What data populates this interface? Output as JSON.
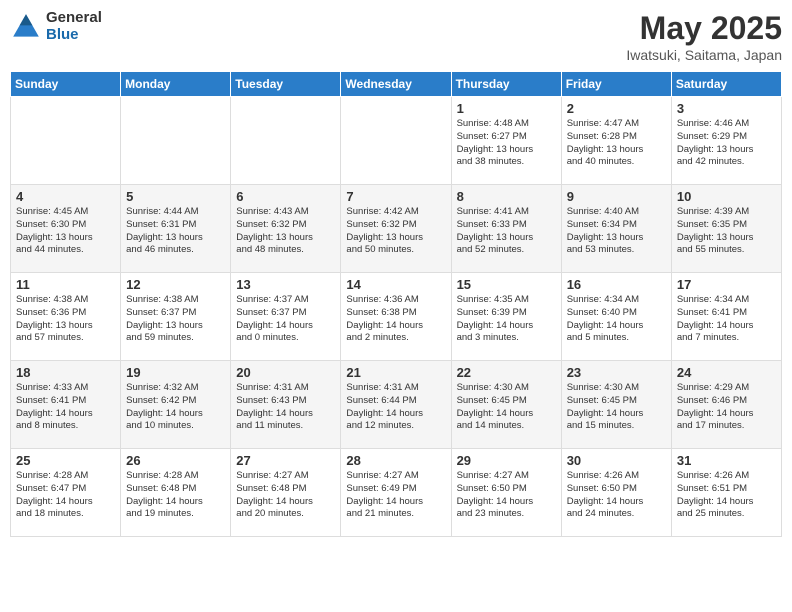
{
  "header": {
    "logo_general": "General",
    "logo_blue": "Blue",
    "month_title": "May 2025",
    "location": "Iwatsuki, Saitama, Japan"
  },
  "days_of_week": [
    "Sunday",
    "Monday",
    "Tuesday",
    "Wednesday",
    "Thursday",
    "Friday",
    "Saturday"
  ],
  "weeks": [
    [
      {
        "day": "",
        "info": ""
      },
      {
        "day": "",
        "info": ""
      },
      {
        "day": "",
        "info": ""
      },
      {
        "day": "",
        "info": ""
      },
      {
        "day": "1",
        "info": "Sunrise: 4:48 AM\nSunset: 6:27 PM\nDaylight: 13 hours\nand 38 minutes."
      },
      {
        "day": "2",
        "info": "Sunrise: 4:47 AM\nSunset: 6:28 PM\nDaylight: 13 hours\nand 40 minutes."
      },
      {
        "day": "3",
        "info": "Sunrise: 4:46 AM\nSunset: 6:29 PM\nDaylight: 13 hours\nand 42 minutes."
      }
    ],
    [
      {
        "day": "4",
        "info": "Sunrise: 4:45 AM\nSunset: 6:30 PM\nDaylight: 13 hours\nand 44 minutes."
      },
      {
        "day": "5",
        "info": "Sunrise: 4:44 AM\nSunset: 6:31 PM\nDaylight: 13 hours\nand 46 minutes."
      },
      {
        "day": "6",
        "info": "Sunrise: 4:43 AM\nSunset: 6:32 PM\nDaylight: 13 hours\nand 48 minutes."
      },
      {
        "day": "7",
        "info": "Sunrise: 4:42 AM\nSunset: 6:32 PM\nDaylight: 13 hours\nand 50 minutes."
      },
      {
        "day": "8",
        "info": "Sunrise: 4:41 AM\nSunset: 6:33 PM\nDaylight: 13 hours\nand 52 minutes."
      },
      {
        "day": "9",
        "info": "Sunrise: 4:40 AM\nSunset: 6:34 PM\nDaylight: 13 hours\nand 53 minutes."
      },
      {
        "day": "10",
        "info": "Sunrise: 4:39 AM\nSunset: 6:35 PM\nDaylight: 13 hours\nand 55 minutes."
      }
    ],
    [
      {
        "day": "11",
        "info": "Sunrise: 4:38 AM\nSunset: 6:36 PM\nDaylight: 13 hours\nand 57 minutes."
      },
      {
        "day": "12",
        "info": "Sunrise: 4:38 AM\nSunset: 6:37 PM\nDaylight: 13 hours\nand 59 minutes."
      },
      {
        "day": "13",
        "info": "Sunrise: 4:37 AM\nSunset: 6:37 PM\nDaylight: 14 hours\nand 0 minutes."
      },
      {
        "day": "14",
        "info": "Sunrise: 4:36 AM\nSunset: 6:38 PM\nDaylight: 14 hours\nand 2 minutes."
      },
      {
        "day": "15",
        "info": "Sunrise: 4:35 AM\nSunset: 6:39 PM\nDaylight: 14 hours\nand 3 minutes."
      },
      {
        "day": "16",
        "info": "Sunrise: 4:34 AM\nSunset: 6:40 PM\nDaylight: 14 hours\nand 5 minutes."
      },
      {
        "day": "17",
        "info": "Sunrise: 4:34 AM\nSunset: 6:41 PM\nDaylight: 14 hours\nand 7 minutes."
      }
    ],
    [
      {
        "day": "18",
        "info": "Sunrise: 4:33 AM\nSunset: 6:41 PM\nDaylight: 14 hours\nand 8 minutes."
      },
      {
        "day": "19",
        "info": "Sunrise: 4:32 AM\nSunset: 6:42 PM\nDaylight: 14 hours\nand 10 minutes."
      },
      {
        "day": "20",
        "info": "Sunrise: 4:31 AM\nSunset: 6:43 PM\nDaylight: 14 hours\nand 11 minutes."
      },
      {
        "day": "21",
        "info": "Sunrise: 4:31 AM\nSunset: 6:44 PM\nDaylight: 14 hours\nand 12 minutes."
      },
      {
        "day": "22",
        "info": "Sunrise: 4:30 AM\nSunset: 6:45 PM\nDaylight: 14 hours\nand 14 minutes."
      },
      {
        "day": "23",
        "info": "Sunrise: 4:30 AM\nSunset: 6:45 PM\nDaylight: 14 hours\nand 15 minutes."
      },
      {
        "day": "24",
        "info": "Sunrise: 4:29 AM\nSunset: 6:46 PM\nDaylight: 14 hours\nand 17 minutes."
      }
    ],
    [
      {
        "day": "25",
        "info": "Sunrise: 4:28 AM\nSunset: 6:47 PM\nDaylight: 14 hours\nand 18 minutes."
      },
      {
        "day": "26",
        "info": "Sunrise: 4:28 AM\nSunset: 6:48 PM\nDaylight: 14 hours\nand 19 minutes."
      },
      {
        "day": "27",
        "info": "Sunrise: 4:27 AM\nSunset: 6:48 PM\nDaylight: 14 hours\nand 20 minutes."
      },
      {
        "day": "28",
        "info": "Sunrise: 4:27 AM\nSunset: 6:49 PM\nDaylight: 14 hours\nand 21 minutes."
      },
      {
        "day": "29",
        "info": "Sunrise: 4:27 AM\nSunset: 6:50 PM\nDaylight: 14 hours\nand 23 minutes."
      },
      {
        "day": "30",
        "info": "Sunrise: 4:26 AM\nSunset: 6:50 PM\nDaylight: 14 hours\nand 24 minutes."
      },
      {
        "day": "31",
        "info": "Sunrise: 4:26 AM\nSunset: 6:51 PM\nDaylight: 14 hours\nand 25 minutes."
      }
    ]
  ]
}
